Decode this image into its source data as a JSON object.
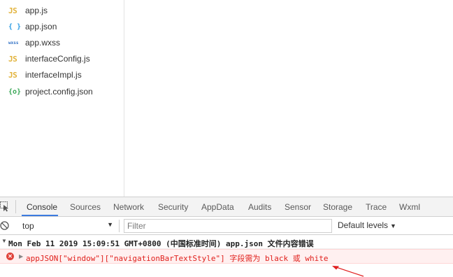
{
  "file_tree": {
    "items": [
      {
        "icon": "JS",
        "icon_name": "js-file-icon",
        "label": "app.js"
      },
      {
        "icon": "{ }",
        "icon_name": "json-file-icon",
        "label": "app.json"
      },
      {
        "icon": "wxss",
        "icon_name": "wxss-file-icon",
        "label": "app.wxss"
      },
      {
        "icon": "JS",
        "icon_name": "js-file-icon",
        "label": "interfaceConfig.js"
      },
      {
        "icon": "JS",
        "icon_name": "js-file-icon",
        "label": "interfaceImpl.js"
      },
      {
        "icon": "{o}",
        "icon_name": "config-file-icon",
        "label": "project.config.json"
      }
    ]
  },
  "devtools": {
    "tabs": [
      "Console",
      "Sources",
      "Network",
      "Security",
      "AppData",
      "Audits",
      "Sensor",
      "Storage",
      "Trace",
      "Wxml"
    ],
    "active_tab": "Console"
  },
  "console_toolbar": {
    "context": "top",
    "filter_placeholder": "Filter",
    "levels": "Default levels"
  },
  "console": {
    "log_message": "Mon Feb 11 2019 15:09:51 GMT+0800 (中国标准时间)  app.json 文件内容错误",
    "error_message": "appJSON[\"window\"][\"navigationBarTextStyle\"] 字段需为 black 或 white"
  },
  "colors": {
    "accent": "#3c7be0",
    "error": "#e0201c",
    "error_bg": "#fff0f0",
    "annotation": "#e02020"
  }
}
